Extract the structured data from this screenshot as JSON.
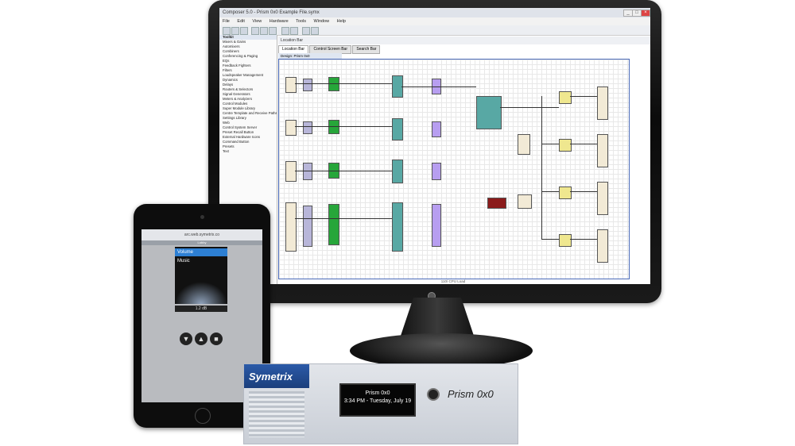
{
  "monitor": {
    "window_title": "Composer 5.0 - Prism 0x0 Example File.symx",
    "menu": [
      "File",
      "Edit",
      "View",
      "Hardware",
      "Tools",
      "Window",
      "Help"
    ],
    "location_label": "Location Bar",
    "tabs": [
      "Location Bar",
      "Control Screen Bar",
      "Search Bar"
    ],
    "design_tab": "Design: Prism 0x0",
    "sidebar_items": [
      "Mixers & Gains",
      "Automixers",
      "Combiners",
      "Conferencing & Paging",
      "EQs",
      "Feedback Fighters",
      "Filters",
      "Loudspeaker Management",
      "Dynamics",
      "Delays",
      "Routers & Selectors",
      "Signal Generators",
      "Meters & Analyzers",
      "Control Modules",
      "Super Module Library",
      "Centre Template and Receive Paths",
      "Settings Library",
      "Web",
      "Control System Server",
      "Preset Recall Button",
      "External Hardware Icons",
      "Command Button",
      "Presets",
      "Text"
    ],
    "status_text": "110/ CPU Load",
    "icons": [
      "power-icon"
    ]
  },
  "tablet": {
    "url": "arc.web.symetrix.co",
    "tab_label": "Lobby",
    "list_items": [
      "Volume",
      "Music"
    ],
    "value_readout": "1.2 dB",
    "buttons": [
      "▼",
      "▲",
      "■"
    ]
  },
  "hardware": {
    "brand": "Symetrix",
    "display_line1": "Prism 0x0",
    "display_line2": "3:34 PM - Tuesday, July 19",
    "model": "Prism 0x0"
  },
  "colors": {
    "symetrix_blue": "#1f4d99",
    "selection_blue": "#2d7fd3",
    "block_green": "#27a63a",
    "block_purple": "#b79ef0",
    "block_teal": "#58a8a4",
    "block_yellow": "#efe78f"
  }
}
